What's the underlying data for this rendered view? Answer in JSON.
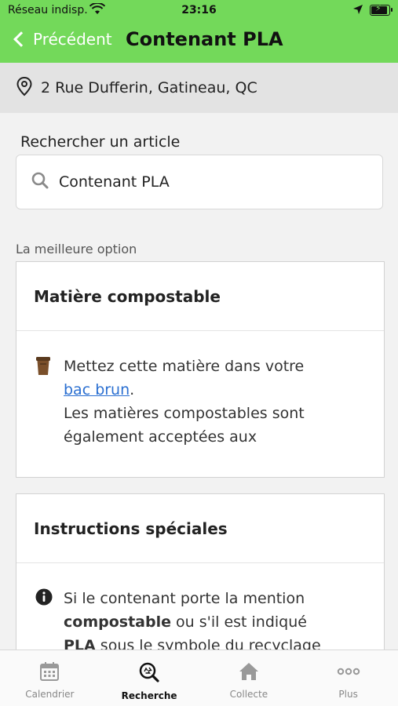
{
  "status_bar": {
    "carrier": "Réseau indisp.",
    "time": "23:16"
  },
  "nav": {
    "back_label": "Précédent",
    "title": "Contenant PLA"
  },
  "address": "2 Rue Dufferin, Gatineau, QC",
  "search": {
    "label": "Rechercher un article",
    "value": "Contenant PLA"
  },
  "best_option_label": "La meilleure option",
  "card1": {
    "title": "Matière compostable",
    "text_before_link": "Mettez cette matière dans votre",
    "link": "bac brun",
    "text_after_link": ".",
    "text_line3": "Les matières compostables sont",
    "text_line4": "également acceptées aux"
  },
  "card2": {
    "title": "Instructions spéciales",
    "line1": "Si le contenant porte la mention",
    "bold1": "compostable",
    "line2_rest": " ou s'il est indiqué",
    "bold2": "PLA",
    "line3_rest": " sous le symbole du recyclage"
  },
  "tabs": [
    {
      "label": "Calendrier",
      "icon": "calendar-icon"
    },
    {
      "label": "Recherche",
      "icon": "search-recycle-icon"
    },
    {
      "label": "Collecte",
      "icon": "home-icon"
    },
    {
      "label": "Plus",
      "icon": "more-icon"
    }
  ],
  "active_tab": "Recherche",
  "colors": {
    "header_green": "#73d95a",
    "link_blue": "#2a6fd1"
  }
}
